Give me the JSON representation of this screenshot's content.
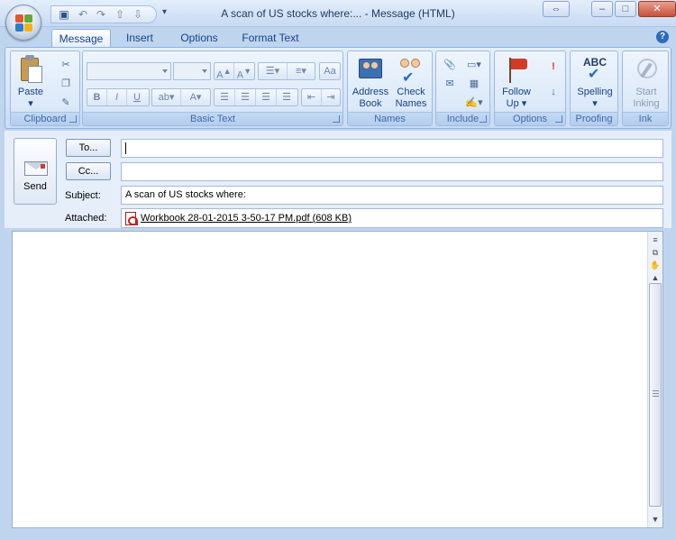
{
  "window": {
    "title": "A scan of US stocks where:... - Message (HTML)",
    "buttons": {
      "restore_other": "⇔",
      "minimize": "–",
      "maximize": "□",
      "close": "✕"
    }
  },
  "quick_access": {
    "save_icon": "save-icon",
    "undo_icon": "undo-icon",
    "redo_icon": "redo-icon",
    "previous_icon": "previous-item-icon",
    "next_icon": "next-item-icon",
    "customize": "▾"
  },
  "tabs": [
    "Message",
    "Insert",
    "Options",
    "Format Text"
  ],
  "help": "?",
  "ribbon": {
    "clipboard": {
      "label": "Clipboard",
      "paste": "Paste",
      "paste_arrow": "▾"
    },
    "basic_text": {
      "label": "Basic Text"
    },
    "names": {
      "label": "Names",
      "address_book": "Address Book",
      "check_names": "Check Names"
    },
    "include": {
      "label": "Include"
    },
    "options": {
      "label": "Options",
      "follow_up": "Follow Up",
      "follow_up_arrow": "▾"
    },
    "proofing": {
      "label": "Proofing",
      "spelling": "Spelling",
      "spelling_arrow": "▾",
      "spelling_icon_text": "ABC"
    },
    "ink": {
      "label": "Ink",
      "start_inking": "Start Inking"
    }
  },
  "form": {
    "send": "Send",
    "to_button": "To...",
    "cc_button": "Cc...",
    "subject_label": "Subject:",
    "attached_label": "Attached:",
    "to_value": "",
    "cc_value": "",
    "subject_value": "A scan of US stocks where:",
    "attachment": "Workbook 28-01-2015 3-50-17 PM.pdf (608 KB)"
  },
  "colors": {
    "accent": "#15428b",
    "ribbon_bg": "#dce9f8",
    "frame_bg": "#bfd5ee",
    "flag_red": "#d23b2a",
    "importance_high": "#e03a1e",
    "importance_low": "#2c6bc0"
  }
}
